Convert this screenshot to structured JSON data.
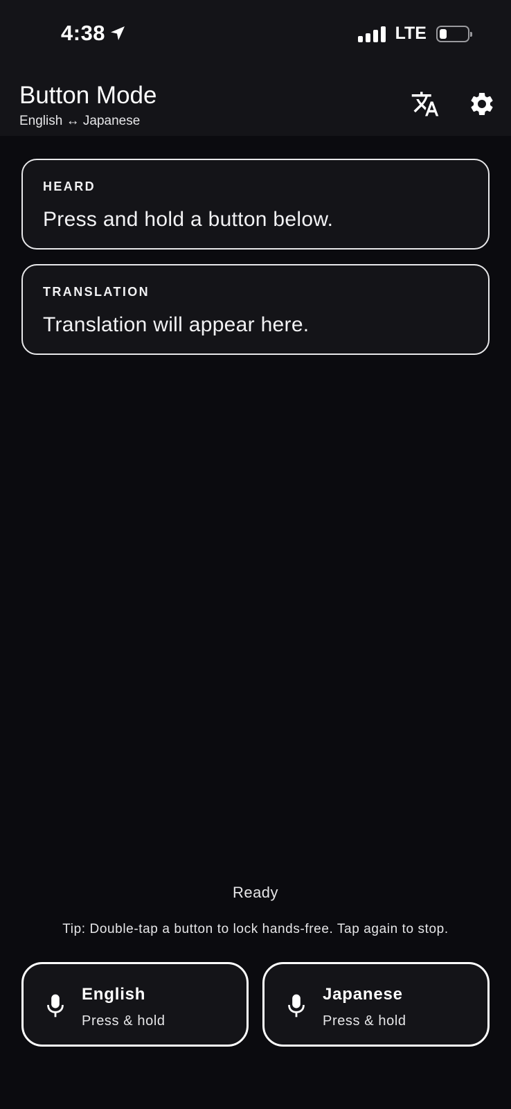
{
  "status_bar": {
    "time": "4:38",
    "network": "LTE",
    "icons": [
      "location-arrow-icon",
      "signal-bars-icon",
      "battery-icon"
    ]
  },
  "header": {
    "title": "Button Mode",
    "subtitle": "English ↔ Japanese",
    "icons": [
      "translate-icon",
      "gear-icon"
    ]
  },
  "heard_card": {
    "label": "HEARD",
    "text": "Press and hold a button below."
  },
  "translation_card": {
    "label": "TRANSLATION",
    "text": "Translation will appear here."
  },
  "status": "Ready",
  "tip": "Tip: Double-tap a button to lock hands-free. Tap again to stop.",
  "buttons": [
    {
      "language": "English",
      "hint": "Press & hold",
      "icon": "microphone-icon"
    },
    {
      "language": "Japanese",
      "hint": "Press & hold",
      "icon": "microphone-icon"
    }
  ],
  "colors": {
    "background": "#0b0b0f",
    "surface": "#141418",
    "border": "#e8e8ea",
    "text": "#ffffff"
  }
}
